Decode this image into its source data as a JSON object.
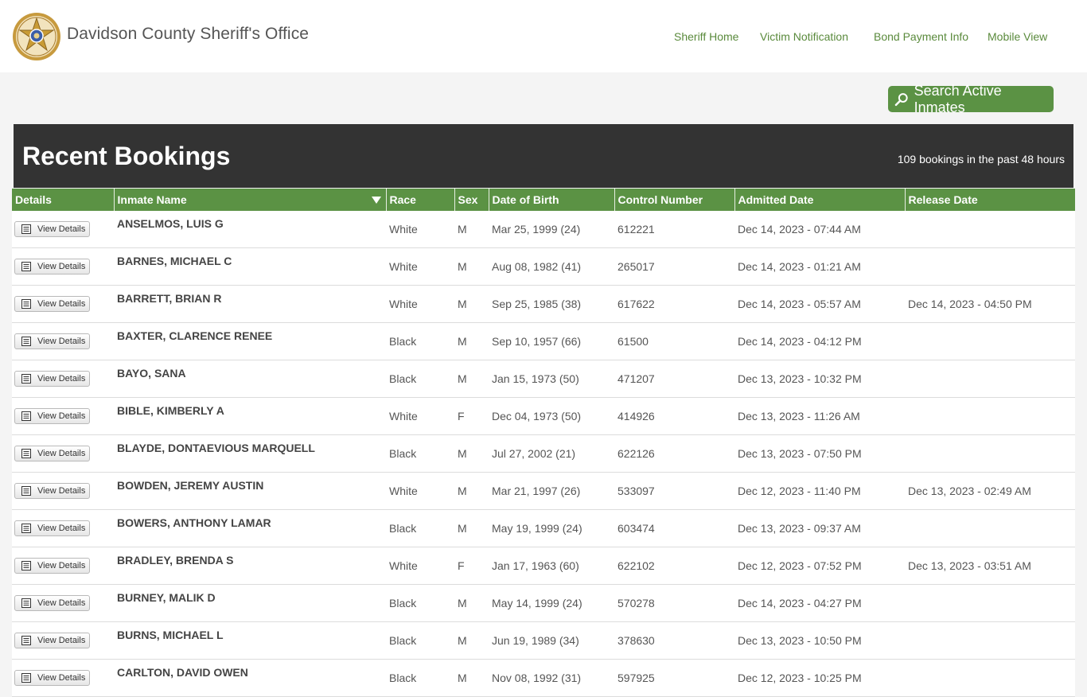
{
  "header": {
    "site_title": "Davidson County Sheriff's Office",
    "logo_icon": "sheriff-star-badge-icon",
    "nav": [
      "Sheriff Home",
      "Victim Notification",
      "Bond Payment Info",
      "Mobile View"
    ]
  },
  "search_button": {
    "label": "Search Active Inmates",
    "icon": "search-icon"
  },
  "bookings": {
    "title": "Recent Bookings",
    "count_text": "109 bookings in the past 48 hours"
  },
  "table": {
    "columns": [
      "Details",
      "Inmate Name",
      "Race",
      "Sex",
      "Date of Birth",
      "Control Number",
      "Admitted Date",
      "Release Date"
    ],
    "sorted_column": "Inmate Name",
    "button_label": "View Details",
    "rows": [
      {
        "name": "ANSELMOS, LUIS  G",
        "race": "White",
        "sex": "M",
        "dob": "Mar 25, 1999 (24)",
        "control": "612221",
        "admitted": "Dec 14, 2023 - 07:44 AM",
        "released": ""
      },
      {
        "name": "BARNES, MICHAEL  C",
        "race": "White",
        "sex": "M",
        "dob": "Aug 08, 1982 (41)",
        "control": "265017",
        "admitted": "Dec 14, 2023 - 01:21 AM",
        "released": ""
      },
      {
        "name": "BARRETT, BRIAN  R",
        "race": "White",
        "sex": "M",
        "dob": "Sep 25, 1985 (38)",
        "control": "617622",
        "admitted": "Dec 14, 2023 - 05:57 AM",
        "released": "Dec 14, 2023 - 04:50 PM"
      },
      {
        "name": "BAXTER, CLARENCE  RENEE",
        "race": "Black",
        "sex": "M",
        "dob": "Sep 10, 1957 (66)",
        "control": "61500",
        "admitted": "Dec 14, 2023 - 04:12 PM",
        "released": ""
      },
      {
        "name": "BAYO, SANA",
        "race": "Black",
        "sex": "M",
        "dob": "Jan 15, 1973 (50)",
        "control": "471207",
        "admitted": "Dec 13, 2023 - 10:32 PM",
        "released": ""
      },
      {
        "name": "BIBLE, KIMBERLY  A",
        "race": "White",
        "sex": "F",
        "dob": "Dec 04, 1973 (50)",
        "control": "414926",
        "admitted": "Dec 13, 2023 - 11:26 AM",
        "released": ""
      },
      {
        "name": "BLAYDE, DONTAEVIOUS  MARQUELL",
        "race": "Black",
        "sex": "M",
        "dob": "Jul 27, 2002 (21)",
        "control": "622126",
        "admitted": "Dec 13, 2023 - 07:50 PM",
        "released": ""
      },
      {
        "name": "BOWDEN, JEREMY  AUSTIN",
        "race": "White",
        "sex": "M",
        "dob": "Mar 21, 1997 (26)",
        "control": "533097",
        "admitted": "Dec 12, 2023 - 11:40 PM",
        "released": "Dec 13, 2023 - 02:49 AM"
      },
      {
        "name": "BOWERS, ANTHONY  LAMAR",
        "race": "Black",
        "sex": "M",
        "dob": "May 19, 1999 (24)",
        "control": "603474",
        "admitted": "Dec 13, 2023 - 09:37 AM",
        "released": ""
      },
      {
        "name": "BRADLEY, BRENDA  S",
        "race": "White",
        "sex": "F",
        "dob": "Jan 17, 1963 (60)",
        "control": "622102",
        "admitted": "Dec 12, 2023 - 07:52 PM",
        "released": "Dec 13, 2023 - 03:51 AM"
      },
      {
        "name": "BURNEY, MALIK  D",
        "race": "Black",
        "sex": "M",
        "dob": "May 14, 1999 (24)",
        "control": "570278",
        "admitted": "Dec 14, 2023 - 04:27 PM",
        "released": ""
      },
      {
        "name": "BURNS, MICHAEL  L",
        "race": "Black",
        "sex": "M",
        "dob": "Jun 19, 1989 (34)",
        "control": "378630",
        "admitted": "Dec 13, 2023 - 10:50 PM",
        "released": ""
      },
      {
        "name": "CARLTON, DAVID  OWEN",
        "race": "Black",
        "sex": "M",
        "dob": "Nov 08, 1992 (31)",
        "control": "597925",
        "admitted": "Dec 12, 2023 - 10:25 PM",
        "released": ""
      }
    ]
  }
}
